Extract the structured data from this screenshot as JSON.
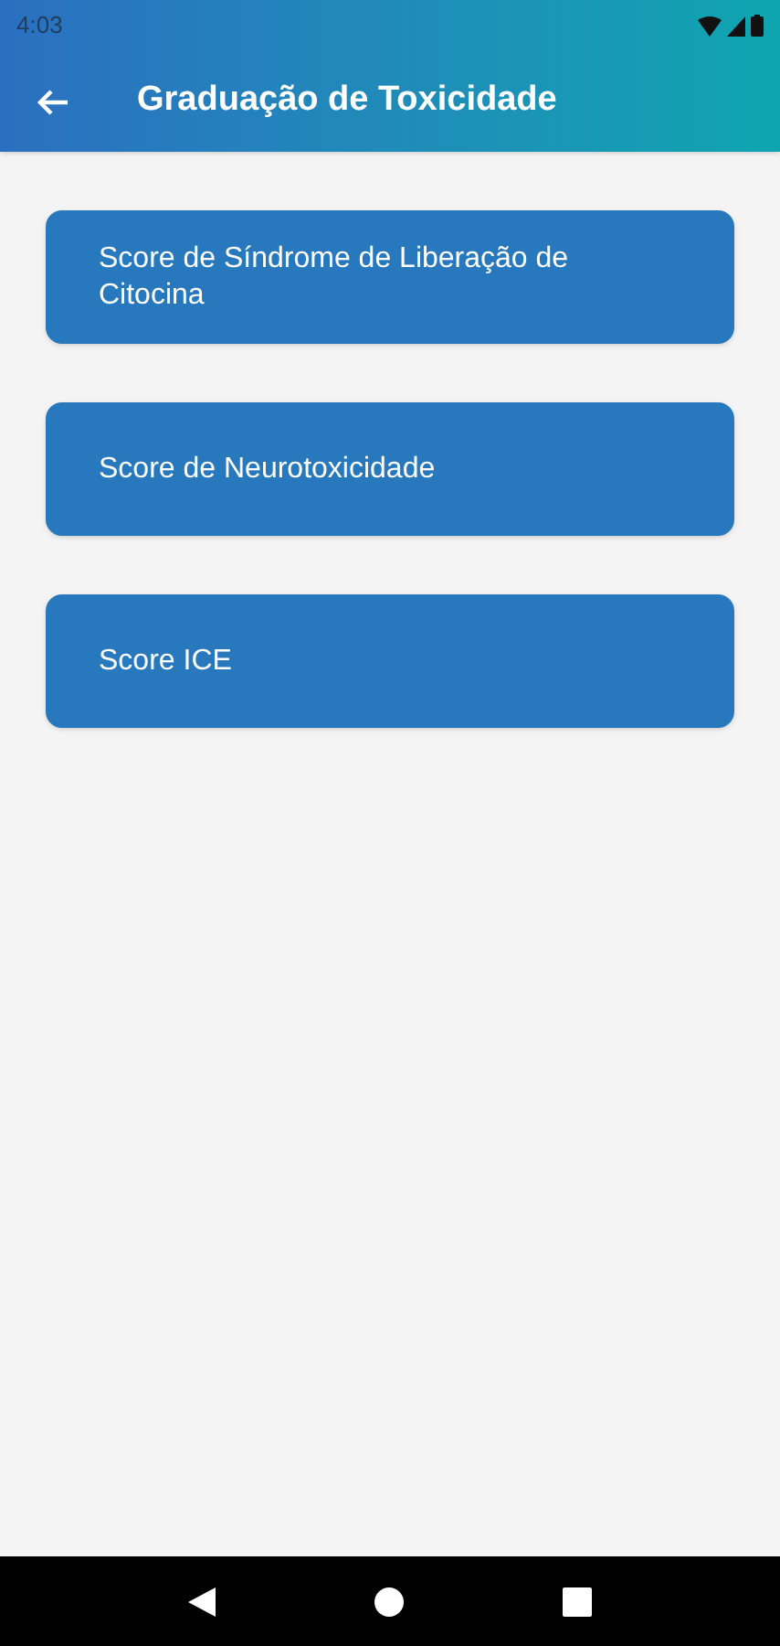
{
  "status_bar": {
    "time": "4:03"
  },
  "app_bar": {
    "title": "Graduação de Toxicidade"
  },
  "menu_items": [
    {
      "label": "Score de Síndrome de Liberação de Citocina"
    },
    {
      "label": "Score de Neurotoxicidade"
    },
    {
      "label": "Score ICE"
    }
  ]
}
